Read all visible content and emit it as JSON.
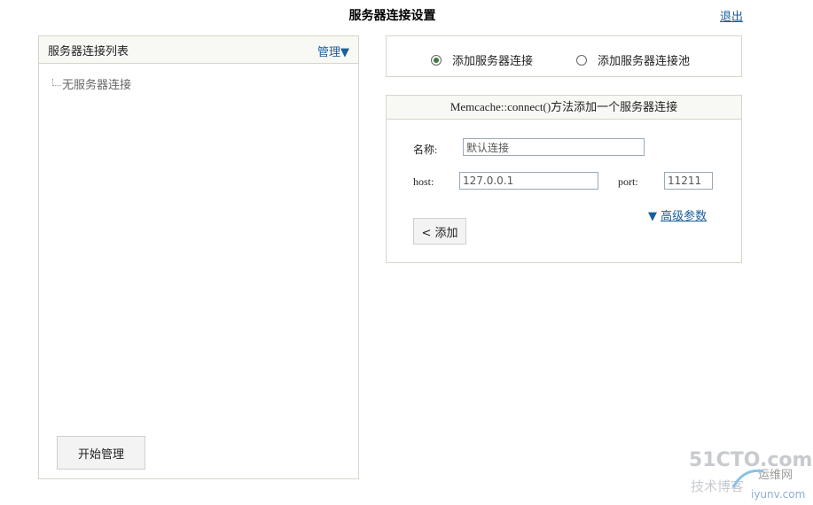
{
  "page": {
    "title": "服务器连接设置",
    "logout_label": "退出"
  },
  "left_panel": {
    "title": "服务器连接列表",
    "manage_label": "管理",
    "manage_icon": "triangle-down-icon",
    "empty_item": "无服务器连接",
    "start_button": "开始管理"
  },
  "mode_selector": {
    "options": [
      {
        "label": "添加服务器连接",
        "checked": true
      },
      {
        "label": "添加服务器连接池",
        "checked": false
      }
    ]
  },
  "form": {
    "header": "Memcache::connect()方法添加一个服务器连接",
    "name_label": "名称:",
    "name_value": "默认连接",
    "host_label": "host:",
    "host_value": "127.0.0.1",
    "port_label": "port:",
    "port_value": "11211",
    "advanced_label": "高级参数",
    "advanced_icon": "triangle-down-icon",
    "add_button": "< 添加"
  },
  "watermark": {
    "line1": "51CTO.com",
    "line2": "技术博客",
    "line3": "运维网",
    "line4": "iyunv.com"
  }
}
